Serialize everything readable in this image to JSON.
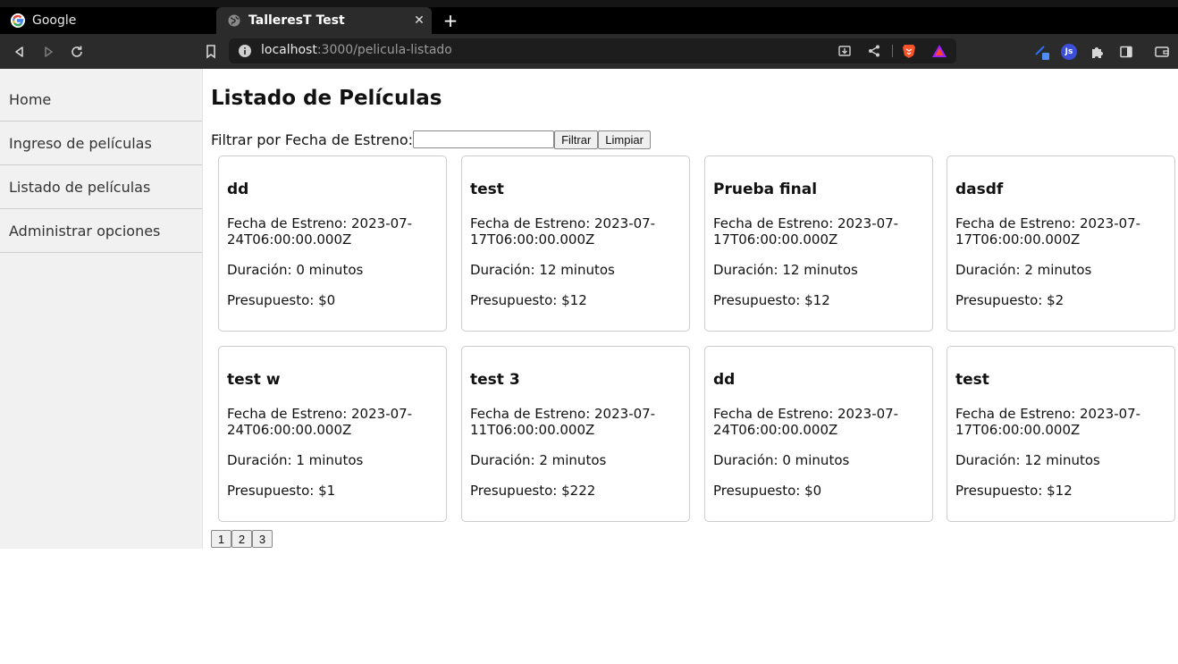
{
  "browser": {
    "tabs": [
      {
        "title": "Google",
        "active": false,
        "favicon": "google-g-icon"
      },
      {
        "title": "TalleresT Test",
        "active": true,
        "favicon": "globe-icon"
      }
    ],
    "url": {
      "host": "localhost",
      "path": ":3000/pelicula-listado"
    },
    "icons": {
      "back": "back-arrow-icon",
      "forward": "forward-arrow-icon",
      "reload": "reload-icon",
      "bookmark": "bookmark-icon",
      "info": "info-icon",
      "install": "install-icon",
      "share": "share-icon",
      "brave": "brave-lion-icon",
      "rewards": "triangle-rewards-icon",
      "extension1": "extension-translate-icon",
      "extension2": "js-extension-icon",
      "extensions": "puzzle-icon",
      "sidebar": "sidebar-toggle-icon",
      "wallet": "wallet-icon"
    },
    "ext_js_label": "Js"
  },
  "sidebar": {
    "items": [
      {
        "label": "Home"
      },
      {
        "label": "Ingreso de películas"
      },
      {
        "label": "Listado de películas"
      },
      {
        "label": "Administrar opciones"
      }
    ]
  },
  "main": {
    "title": "Listado de Películas",
    "filter": {
      "label": "Filtrar por Fecha de Estreno:",
      "value": "",
      "filter_button": "Filtrar",
      "clear_button": "Limpiar"
    },
    "cards": [
      {
        "title": "dd",
        "date": "Fecha de Estreno: 2023-07-24T06:00:00.000Z",
        "duration": "Duración: 0 minutos",
        "budget": "Presupuesto: $0"
      },
      {
        "title": "test",
        "date": "Fecha de Estreno: 2023-07-17T06:00:00.000Z",
        "duration": "Duración: 12 minutos",
        "budget": "Presupuesto: $12"
      },
      {
        "title": "Prueba final",
        "date": "Fecha de Estreno: 2023-07-17T06:00:00.000Z",
        "duration": "Duración: 12 minutos",
        "budget": "Presupuesto: $12"
      },
      {
        "title": "dasdf",
        "date": "Fecha de Estreno: 2023-07-17T06:00:00.000Z",
        "duration": "Duración: 2 minutos",
        "budget": "Presupuesto: $2"
      },
      {
        "title": "test w",
        "date": "Fecha de Estreno: 2023-07-24T06:00:00.000Z",
        "duration": "Duración: 1 minutos",
        "budget": "Presupuesto: $1"
      },
      {
        "title": "test 3",
        "date": "Fecha de Estreno: 2023-07-11T06:00:00.000Z",
        "duration": "Duración: 2 minutos",
        "budget": "Presupuesto: $222"
      },
      {
        "title": "dd",
        "date": "Fecha de Estreno: 2023-07-24T06:00:00.000Z",
        "duration": "Duración: 0 minutos",
        "budget": "Presupuesto: $0"
      },
      {
        "title": "test",
        "date": "Fecha de Estreno: 2023-07-17T06:00:00.000Z",
        "duration": "Duración: 12 minutos",
        "budget": "Presupuesto: $12"
      }
    ],
    "pages": [
      "1",
      "2",
      "3"
    ]
  }
}
